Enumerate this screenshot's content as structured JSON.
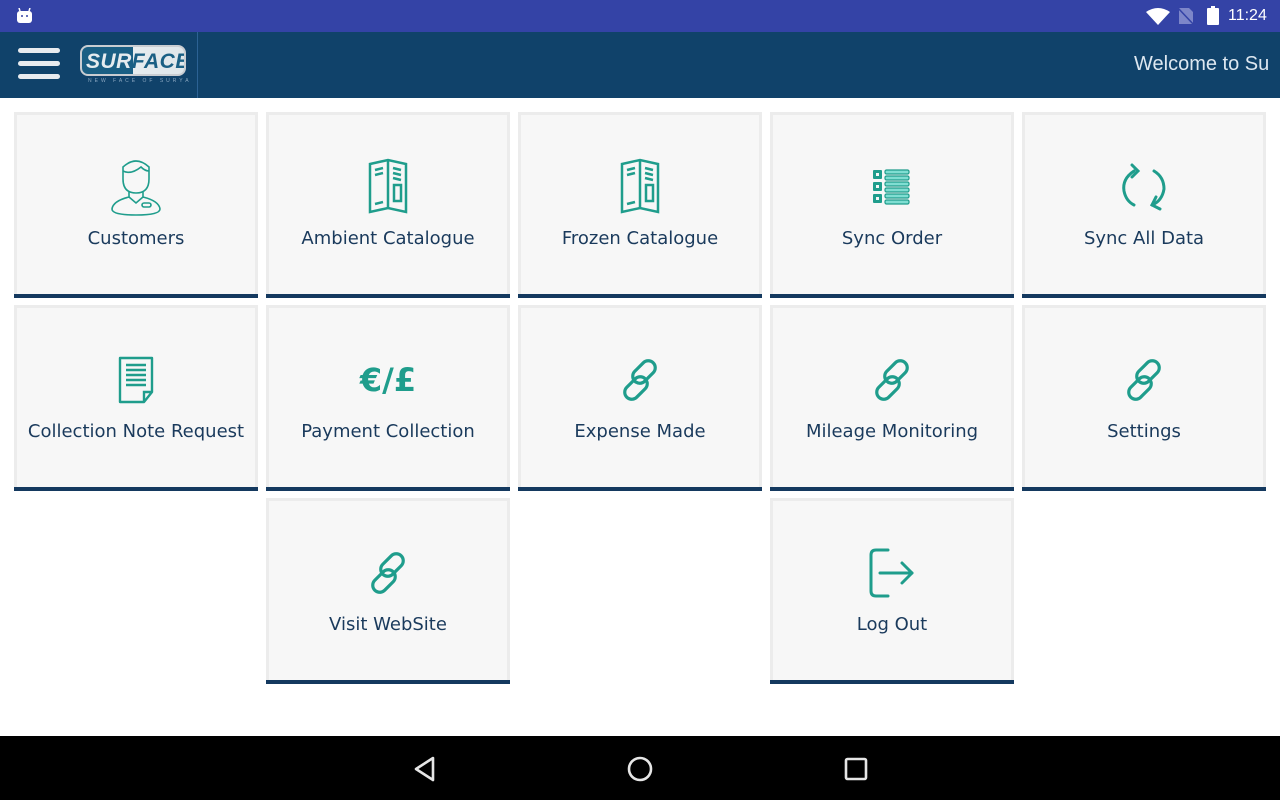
{
  "status_bar": {
    "left_icon": "android-debug-icon",
    "icons": [
      "wifi-icon",
      "no-sim-icon",
      "battery-icon"
    ],
    "time": "11:24"
  },
  "app_bar": {
    "menu_icon": "hamburger-menu-icon",
    "logo": {
      "text_part1": "SUR",
      "text_part2": "FACE",
      "tagline": "NEW FACE OF SURYA"
    },
    "welcome_text": "Welcome to Su"
  },
  "tiles": [
    {
      "label": "Customers",
      "icon": "customer-person-icon"
    },
    {
      "label": "Ambient Catalogue",
      "icon": "catalogue-brochure-icon"
    },
    {
      "label": "Frozen Catalogue",
      "icon": "catalogue-brochure-icon"
    },
    {
      "label": "Sync Order",
      "icon": "list-icon"
    },
    {
      "label": "Sync All Data",
      "icon": "sync-icon"
    },
    {
      "label": "Collection Note Request",
      "icon": "document-icon"
    },
    {
      "label": "Payment Collection",
      "icon": "currency-icon",
      "icon_text": "€/£"
    },
    {
      "label": "Expense Made",
      "icon": "link-icon"
    },
    {
      "label": "Mileage Monitoring",
      "icon": "link-icon"
    },
    {
      "label": "Settings",
      "icon": "link-icon"
    },
    {
      "label": "Visit WebSite",
      "icon": "link-icon"
    },
    {
      "label": "Log Out",
      "icon": "logout-icon"
    }
  ],
  "nav_bar": {
    "buttons": [
      "back-icon",
      "home-icon",
      "recents-icon"
    ]
  },
  "colors": {
    "status_bar": "#3443a6",
    "app_bar": "#10426a",
    "icon_accent": "#1f9d8c",
    "tile_label": "#1a3a5c",
    "tile_bar": "#14395f",
    "tile_bg": "#f7f7f7"
  }
}
